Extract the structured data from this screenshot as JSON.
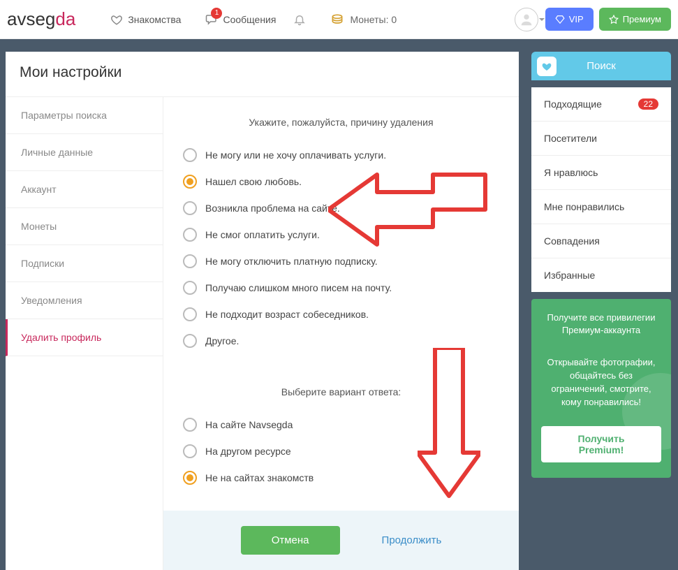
{
  "header": {
    "logo_part1": "avseg",
    "logo_part2": "da",
    "nav_dating": "Знакомства",
    "nav_messages": "Сообщения",
    "messages_badge": "1",
    "coins_label": "Монеты: 0",
    "vip_label": "VIP",
    "premium_label": "Премиум"
  },
  "page_title": "Мои настройки",
  "sidebar": {
    "items": [
      "Параметры поиска",
      "Личные данные",
      "Аккаунт",
      "Монеты",
      "Подписки",
      "Уведомления",
      "Удалить профиль"
    ]
  },
  "form": {
    "heading1": "Укажите, пожалуйста, причину удаления",
    "reasons": [
      "Не могу или не хочу оплачивать услуги.",
      "Нашел свою любовь.",
      "Возникла проблема на сайте.",
      "Не смог оплатить услуги.",
      "Не могу отключить платную подписку.",
      "Получаю слишком много писем на почту.",
      "Не подходит возраст собеседников.",
      "Другое."
    ],
    "heading2": "Выберите вариант ответа:",
    "sources": [
      "На сайте Navsegda",
      "На другом ресурсе",
      "Не на сайтах знакомств"
    ],
    "cancel": "Отмена",
    "continue": "Продолжить"
  },
  "right": {
    "search_tab": "Поиск",
    "items": [
      {
        "label": "Подходящие",
        "badge": "22"
      },
      {
        "label": "Посетители"
      },
      {
        "label": "Я нравлюсь"
      },
      {
        "label": "Мне понравились"
      },
      {
        "label": "Совпадения"
      },
      {
        "label": "Избранные"
      }
    ],
    "promo_title": "Получите все привилегии Премиум-аккаунта",
    "promo_text": "Открывайте фотографии, общайтесь без ограничений, смотрите, кому понравились!",
    "promo_btn": "Получить Premium!"
  }
}
